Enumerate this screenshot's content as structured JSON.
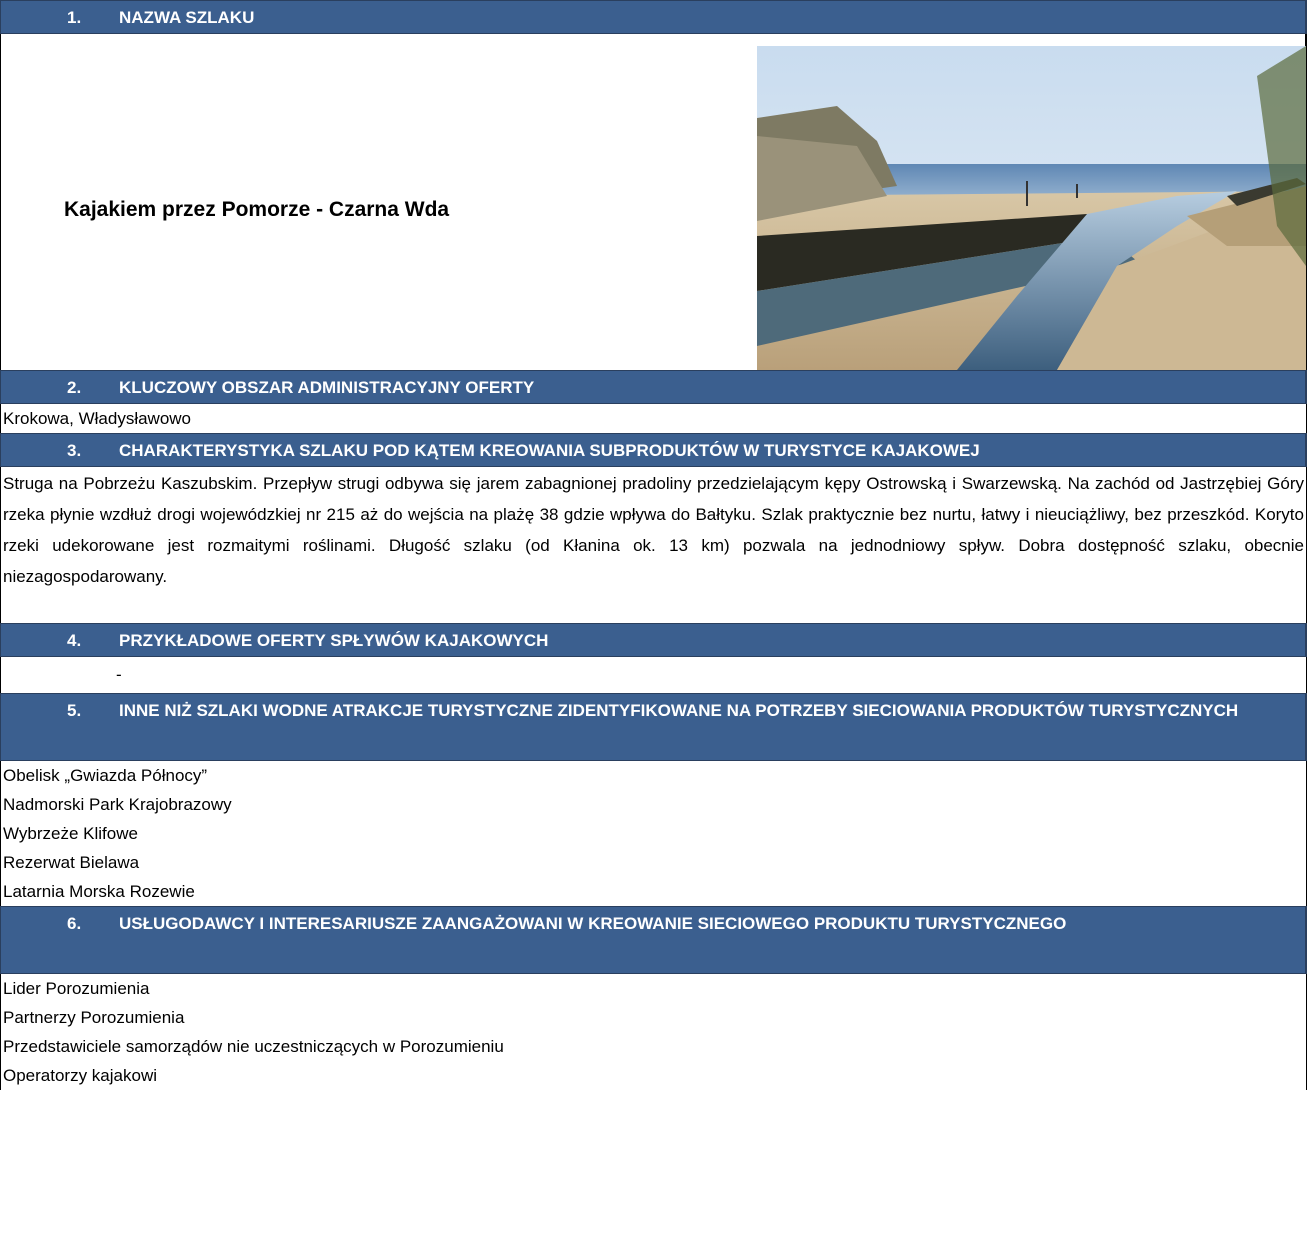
{
  "sections": {
    "s1": {
      "num": "1.",
      "title": "NAZWA SZLAKU"
    },
    "s2": {
      "num": "2.",
      "title": "KLUCZOWY OBSZAR ADMINISTRACYJNY OFERTY"
    },
    "s3": {
      "num": "3.",
      "title": "CHARAKTERYSTYKA SZLAKU POD KĄTEM KREOWANIA SUBPRODUKTÓW W TURYSTYCE KAJAKOWEJ"
    },
    "s4": {
      "num": "4.",
      "title": "PRZYKŁADOWE OFERTY SPŁYWÓW KAJAKOWYCH"
    },
    "s5": {
      "num": "5.",
      "title": "INNE NIŻ SZLAKI WODNE ATRAKCJE TURYSTYCZNE ZIDENTYFIKOWANE NA POTRZEBY SIECIOWANIA PRODUKTÓW TURYSTYCZNYCH"
    },
    "s6": {
      "num": "6.",
      "title": "USŁUGODAWCY I INTERESARIUSZE ZAANGAŻOWANI W KREOWANIE SIECIOWEGO PRODUKTU TURYSTYCZNEGO"
    }
  },
  "trail_name": "Kajakiem przez Pomorze - Czarna Wda",
  "area": "Krokowa, Władysławowo",
  "description": "Struga na Pobrzeżu Kaszubskim. Przepływ strugi odbywa się jarem zabagnionej pradoliny przedzielającym kępy Ostrowską i Swarzewską. Na zachód od Jastrzębiej Góry rzeka płynie wzdłuż drogi wojewódzkiej nr 215 aż do wejścia na plażę 38 gdzie wpływa do Bałtyku. Szlak praktycznie bez nurtu, łatwy i nieuciążliwy, bez przeszkód. Koryto rzeki udekorowane jest rozmaitymi roślinami. Długość szlaku (od Kłanina ok. 13 km) pozwala na jednodniowy spływ. Dobra dostępność szlaku, obecnie niezagospodarowany.",
  "offers_placeholder": "-",
  "attractions": [
    "Obelisk „Gwiazda Północy”",
    "Nadmorski Park Krajobrazowy",
    "Wybrzeże Klifowe",
    "Rezerwat Bielawa",
    "Latarnia Morska Rozewie"
  ],
  "stakeholders": [
    "Lider Porozumienia",
    "Partnerzy Porozumienia",
    "Przedstawiciele samorządów nie uczestniczących w Porozumieniu",
    "Operatorzy kajakowi"
  ],
  "colors": {
    "header_bg": "#3b5f8f",
    "header_text": "#ffffff"
  }
}
